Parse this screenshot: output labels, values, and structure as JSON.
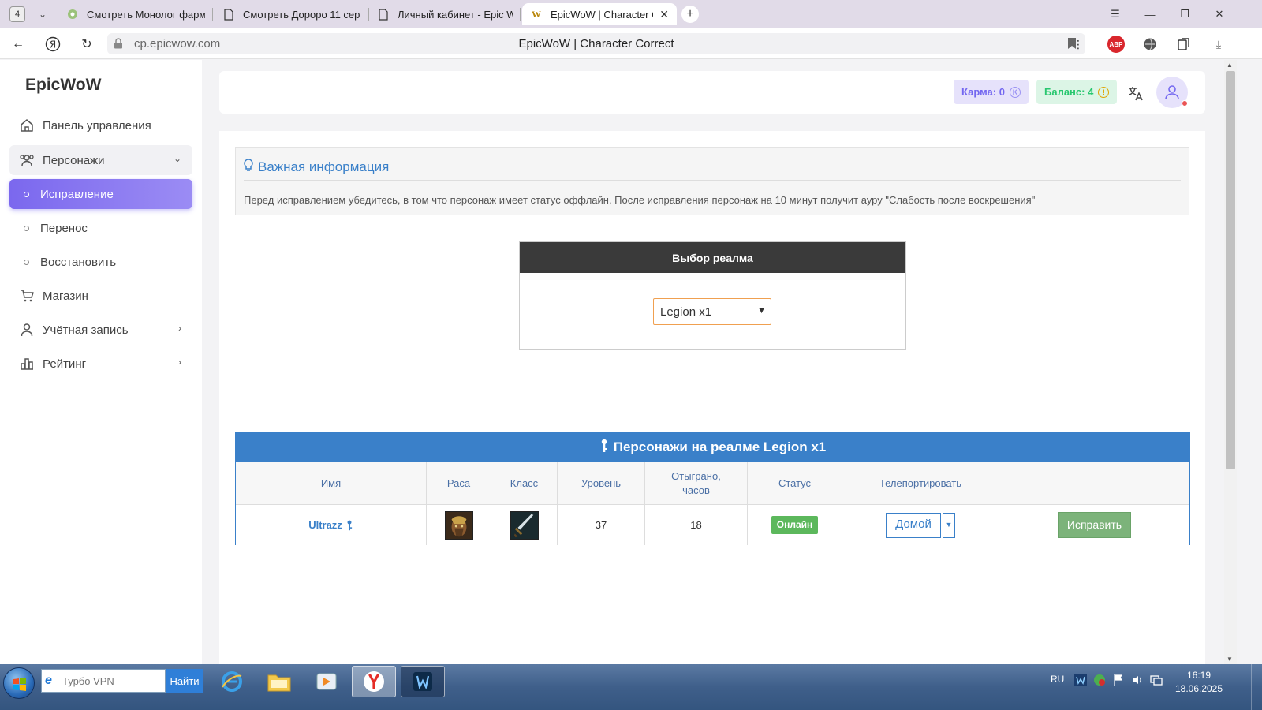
{
  "browser": {
    "tab_count": "4",
    "tabs": [
      {
        "title": "Смотреть Монолог фарм"
      },
      {
        "title": "Смотреть Дороро 11 сер"
      },
      {
        "title": "Личный кабинет - Epic W"
      },
      {
        "title": "EpicWoW | Character C"
      }
    ],
    "url_domain": "cp.epicwow.com",
    "page_title": "EpicWoW | Character Correct",
    "abp_label": "ABP"
  },
  "sidebar": {
    "brand": "EpicWoW",
    "items": [
      {
        "label": "Панель управления",
        "icon": "home-icon"
      },
      {
        "label": "Персонажи",
        "icon": "users-icon"
      },
      {
        "label": "Исправление"
      },
      {
        "label": "Перенос"
      },
      {
        "label": "Восстановить"
      },
      {
        "label": "Магазин",
        "icon": "cart-icon"
      },
      {
        "label": "Учётная запись",
        "icon": "user-icon"
      },
      {
        "label": "Рейтинг",
        "icon": "bar-chart-icon"
      }
    ]
  },
  "header": {
    "karma_label": "Карма: 0",
    "karma_coin": "K",
    "balance_label": "Баланс: 4",
    "balance_coin": "!"
  },
  "info": {
    "title": "Важная информация",
    "text": "Перед исправлением убедитесь, в том что персонаж имеет статус оффлайн. После исправления персонаж на 10 минут получит ауру \"Слабость после воскрешения\""
  },
  "realm": {
    "heading": "Выбор реалма",
    "selected": "Legion x1"
  },
  "characters": {
    "heading": "Персонажи на реалме Legion x1",
    "columns": [
      "Имя",
      "Раса",
      "Класс",
      "Уровень",
      "Отыграно, часов",
      "Статус",
      "Телепортировать",
      ""
    ],
    "rows": [
      {
        "name": "Ultrazz",
        "level": "37",
        "played_hours": "18",
        "status": "Онлайн",
        "teleport": "Домой",
        "action": "Исправить"
      }
    ]
  },
  "taskbar": {
    "search_placeholder": "Турбо VPN",
    "search_button": "Найти",
    "lang": "RU",
    "time": "16:19",
    "date": "18.06.2025"
  },
  "colors": {
    "accent": "#7367f0",
    "info_blue": "#3a80c9",
    "online_green": "#5cb85c",
    "fix_button": "#7cb37a"
  }
}
